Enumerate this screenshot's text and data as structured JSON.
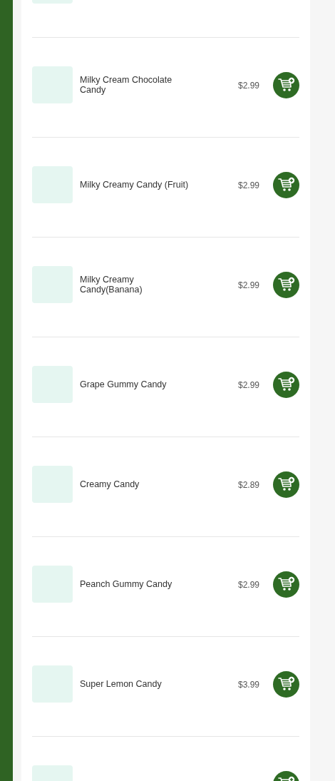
{
  "products": [
    {
      "kind": "cut_top"
    },
    {
      "kind": "full",
      "name": "Milky Cream Chocolate Candy",
      "price": "$2.99"
    },
    {
      "kind": "full",
      "name": "Milky Creamy Candy (Fruit)",
      "price": "$2.99"
    },
    {
      "kind": "full",
      "name": "Milky Creamy Candy(Banana)",
      "price": "$2.99"
    },
    {
      "kind": "full",
      "name": "Grape Gummy Candy",
      "price": "$2.99"
    },
    {
      "kind": "full",
      "name": "Creamy Candy",
      "price": "$2.89"
    },
    {
      "kind": "full",
      "name": "Peanch Gummy Candy",
      "price": "$2.99"
    },
    {
      "kind": "full",
      "name": "Super Lemon Candy",
      "price": "$3.99"
    },
    {
      "kind": "cut"
    }
  ]
}
